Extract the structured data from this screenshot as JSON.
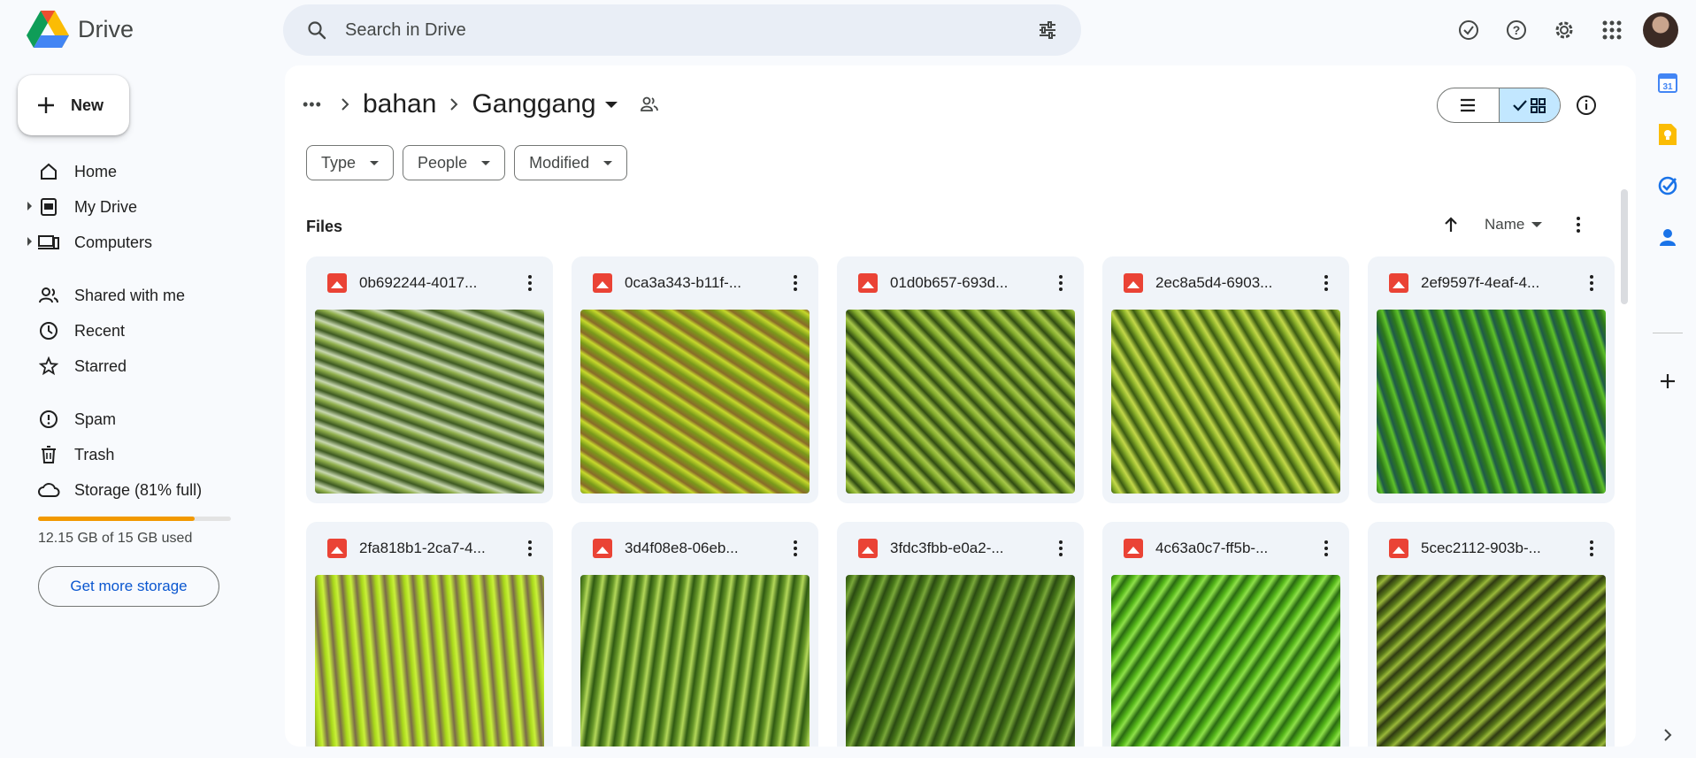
{
  "app": {
    "name": "Drive"
  },
  "search": {
    "placeholder": "Search in Drive"
  },
  "top_icons": [
    "offline-ready-icon",
    "help-icon",
    "settings-icon",
    "apps-grid-icon"
  ],
  "new_button": {
    "label": "New"
  },
  "sidebar": {
    "items": [
      {
        "label": "Home",
        "icon": "home-icon"
      },
      {
        "label": "My Drive",
        "icon": "my-drive-icon",
        "expandable": true
      },
      {
        "label": "Computers",
        "icon": "computers-icon",
        "expandable": true
      },
      {
        "label": "Shared with me",
        "icon": "shared-icon"
      },
      {
        "label": "Recent",
        "icon": "clock-icon"
      },
      {
        "label": "Starred",
        "icon": "star-icon"
      },
      {
        "label": "Spam",
        "icon": "spam-icon"
      },
      {
        "label": "Trash",
        "icon": "trash-icon"
      },
      {
        "label": "Storage (81% full)",
        "icon": "cloud-icon"
      }
    ],
    "storage": {
      "used_text": "12.15 GB of 15 GB used",
      "fraction": 0.81,
      "button": "Get more storage",
      "bar_color": "#f29900"
    }
  },
  "breadcrumb": {
    "items": [
      "bahan",
      "Ganggang"
    ]
  },
  "filters": [
    "Type",
    "People",
    "Modified"
  ],
  "section": {
    "label": "Files"
  },
  "sort": {
    "label": "Name"
  },
  "files": [
    {
      "name": "0b692244-4017...",
      "c1": "#3e5a22",
      "c2": "#8fae4a",
      "c3": "#c8d7b0"
    },
    {
      "name": "0ca3a343-b11f-...",
      "c1": "#7a9a1a",
      "c2": "#c6d82c",
      "c3": "#8a6a2a"
    },
    {
      "name": "01d0b657-693d...",
      "c1": "#2f4a12",
      "c2": "#7fa82a",
      "c3": "#a8c84a"
    },
    {
      "name": "2ec8a5d4-6903...",
      "c1": "#3a5a12",
      "c2": "#8cb22a",
      "c3": "#c4d84a"
    },
    {
      "name": "2ef9597f-4eaf-4...",
      "c1": "#2e7a1a",
      "c2": "#5ec22a",
      "c3": "#1f5a4a"
    },
    {
      "name": "2fa818b1-2ca7-4...",
      "c1": "#7a6a4a",
      "c2": "#a8d81a",
      "c3": "#c9f03a"
    },
    {
      "name": "3d4f08e8-06eb...",
      "c1": "#2f5a12",
      "c2": "#6a9a2a",
      "c3": "#b4d85a"
    },
    {
      "name": "3fdc3fbb-e0a2-...",
      "c1": "#2a4a12",
      "c2": "#4a7a1a",
      "c3": "#7aa83a"
    },
    {
      "name": "4c63a0c7-ff5b-...",
      "c1": "#2a6a12",
      "c2": "#56b81a",
      "c3": "#8ee04a"
    },
    {
      "name": "5cec2112-903b-...",
      "c1": "#2f3a12",
      "c2": "#5a7a1a",
      "c3": "#9ab83a"
    }
  ],
  "right_panel": [
    "calendar-icon",
    "keep-icon",
    "tasks-icon",
    "contacts-icon"
  ]
}
